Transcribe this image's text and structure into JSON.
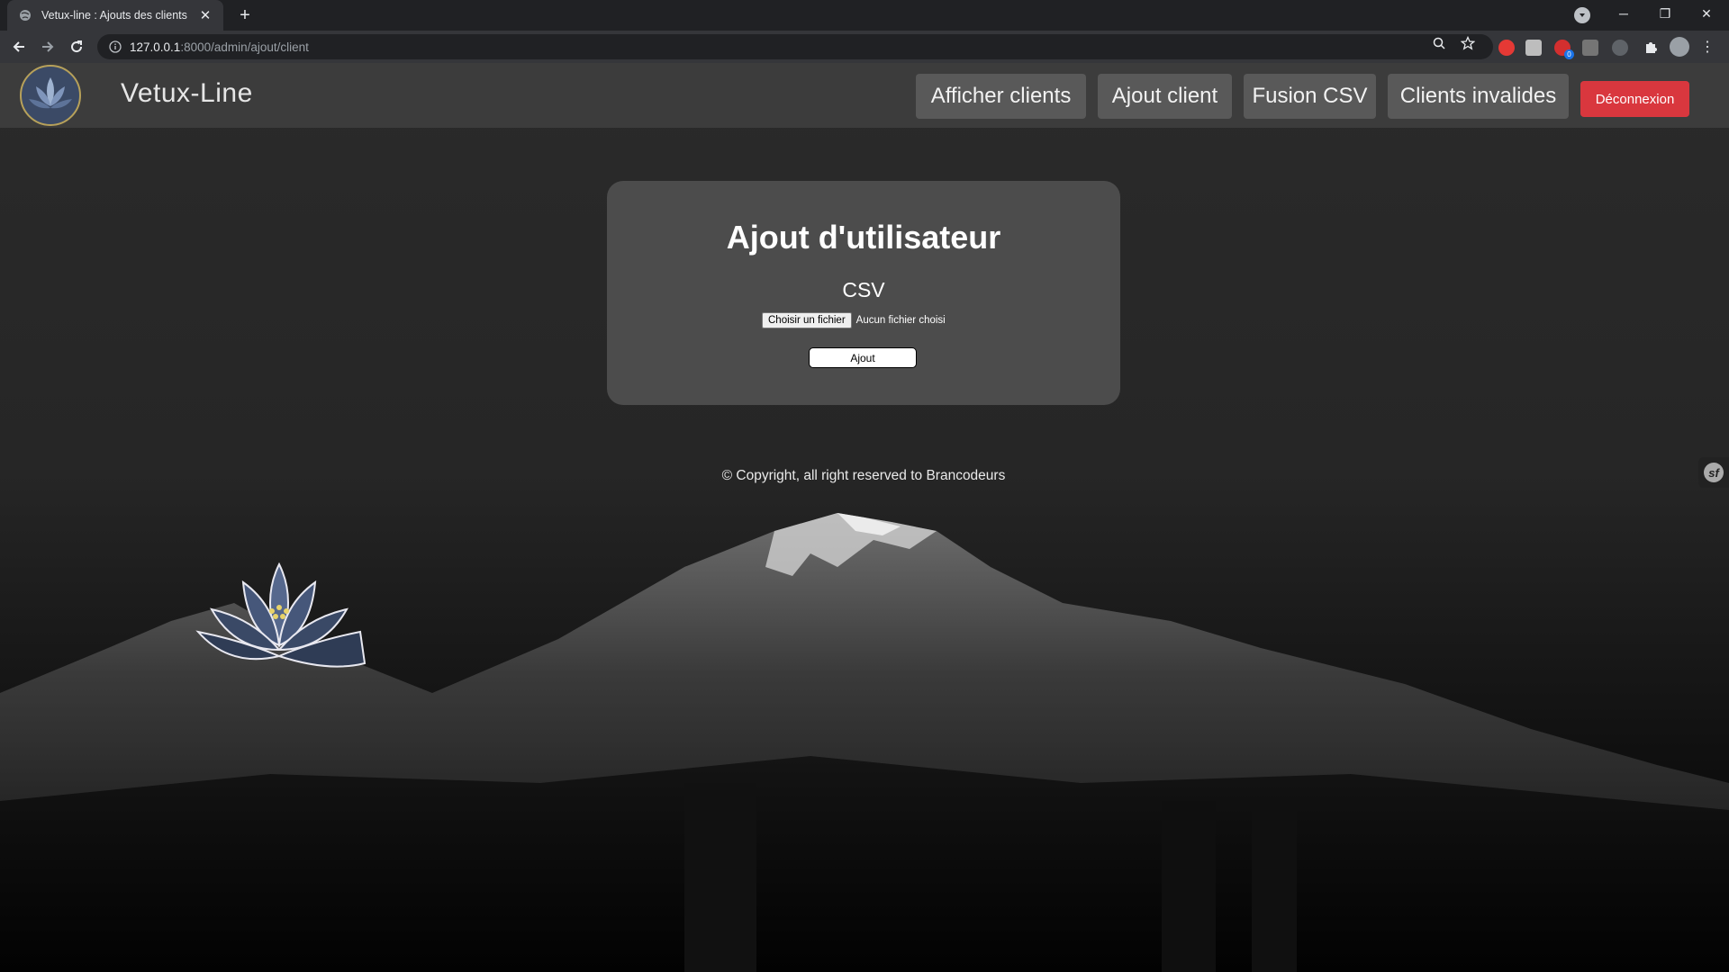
{
  "browser": {
    "tab_title": "Vetux-line : Ajouts des clients",
    "url_host": "127.0.0.1",
    "url_path": ":8000/admin/ajout/client"
  },
  "navbar": {
    "brand": "Vetux-Line",
    "links": [
      {
        "label": "Afficher clients"
      },
      {
        "label": "Ajout client"
      },
      {
        "label": "Fusion CSV"
      },
      {
        "label": "Clients invalides"
      }
    ],
    "logout_label": "Déconnexion",
    "logout_color": "#d9373e"
  },
  "form": {
    "title": "Ajout d'utilisateur",
    "subtitle": "CSV",
    "file_button": "Choisir un fichier",
    "file_status": "Aucun fichier choisi",
    "submit_label": "Ajout"
  },
  "footer": {
    "copyright": "© Copyright, all right reserved to Brancodeurs"
  },
  "extensions": {
    "badge_count": "0"
  }
}
